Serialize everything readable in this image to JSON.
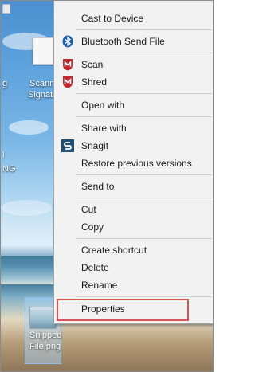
{
  "desktop": {
    "icons": [
      {
        "label_line1": "Scann",
        "label_line2": "Signat"
      },
      {
        "label_line1": "Snipped",
        "label_line2": "File.png"
      }
    ],
    "edge_labels": [
      {
        "text": "g"
      },
      {
        "text": "l"
      },
      {
        "text": "NG"
      }
    ]
  },
  "context_menu": {
    "items": [
      {
        "label": "Cast to Device"
      },
      {
        "label": "Bluetooth Send File",
        "icon": "bluetooth-icon"
      },
      {
        "label": "Scan",
        "icon": "mcafee-icon"
      },
      {
        "label": "Shred",
        "icon": "mcafee-icon"
      },
      {
        "label": "Open with"
      },
      {
        "label": "Share with"
      },
      {
        "label": "Snagit",
        "icon": "snagit-icon"
      },
      {
        "label": "Restore previous versions"
      },
      {
        "label": "Send to"
      },
      {
        "label": "Cut"
      },
      {
        "label": "Copy"
      },
      {
        "label": "Create shortcut"
      },
      {
        "label": "Delete"
      },
      {
        "label": "Rename"
      },
      {
        "label": "Properties"
      }
    ],
    "highlighted_item": "Properties",
    "highlight_color": "#d9534f"
  },
  "colors": {
    "menu_background": "#f2f2f2",
    "bluetooth": "#1f5fb5",
    "mcafee": "#c0282d",
    "snagit": "#1e4f78"
  }
}
